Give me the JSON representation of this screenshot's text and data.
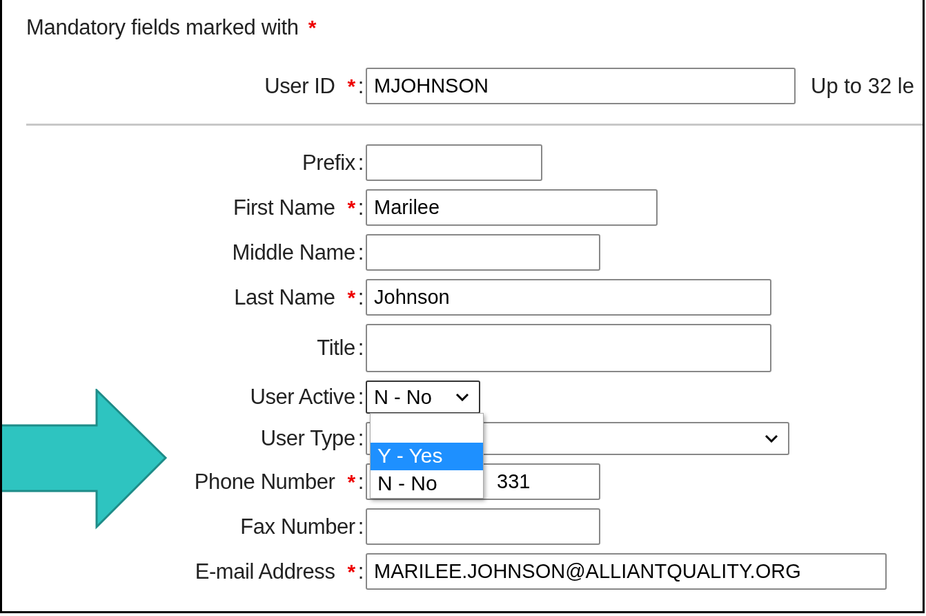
{
  "header": {
    "text": "Mandatory fields marked with",
    "marker": "*"
  },
  "user_id": {
    "label": "User ID",
    "required_mark": "*",
    "colon": ":",
    "value": "MJOHNSON",
    "hint": "Up to 32 le"
  },
  "fields": [
    {
      "kind": "text",
      "label": "Prefix",
      "colon": ":"
    },
    {
      "kind": "text",
      "label": "First Name",
      "required_mark": "*",
      "colon": ":",
      "value": "Marilee"
    },
    {
      "kind": "text",
      "label": "Middle Name",
      "colon": ":"
    },
    {
      "kind": "text",
      "label": "Last Name",
      "required_mark": "*",
      "colon": ":",
      "value": "Johnson"
    },
    {
      "kind": "textarea",
      "label": "Title",
      "colon": ":"
    },
    {
      "kind": "select",
      "label": "User Active",
      "colon": ":",
      "value": "N - No",
      "expanded": true,
      "options": [
        {
          "label": "Y - Yes",
          "highlighted": true
        },
        {
          "label": "N - No",
          "highlighted": false
        }
      ]
    },
    {
      "kind": "select",
      "label": "User Type",
      "colon": ":",
      "expanded": false
    },
    {
      "kind": "text",
      "label": "Phone Number",
      "required_mark": "*",
      "colon": ":",
      "value": "331"
    },
    {
      "kind": "text",
      "label": "Fax Number",
      "colon": ":"
    },
    {
      "kind": "text",
      "label": "E-mail Address",
      "required_mark": "*",
      "colon": ":",
      "value": "MARILEE.JOHNSON@ALLIANTQUALITY.ORG"
    }
  ]
}
